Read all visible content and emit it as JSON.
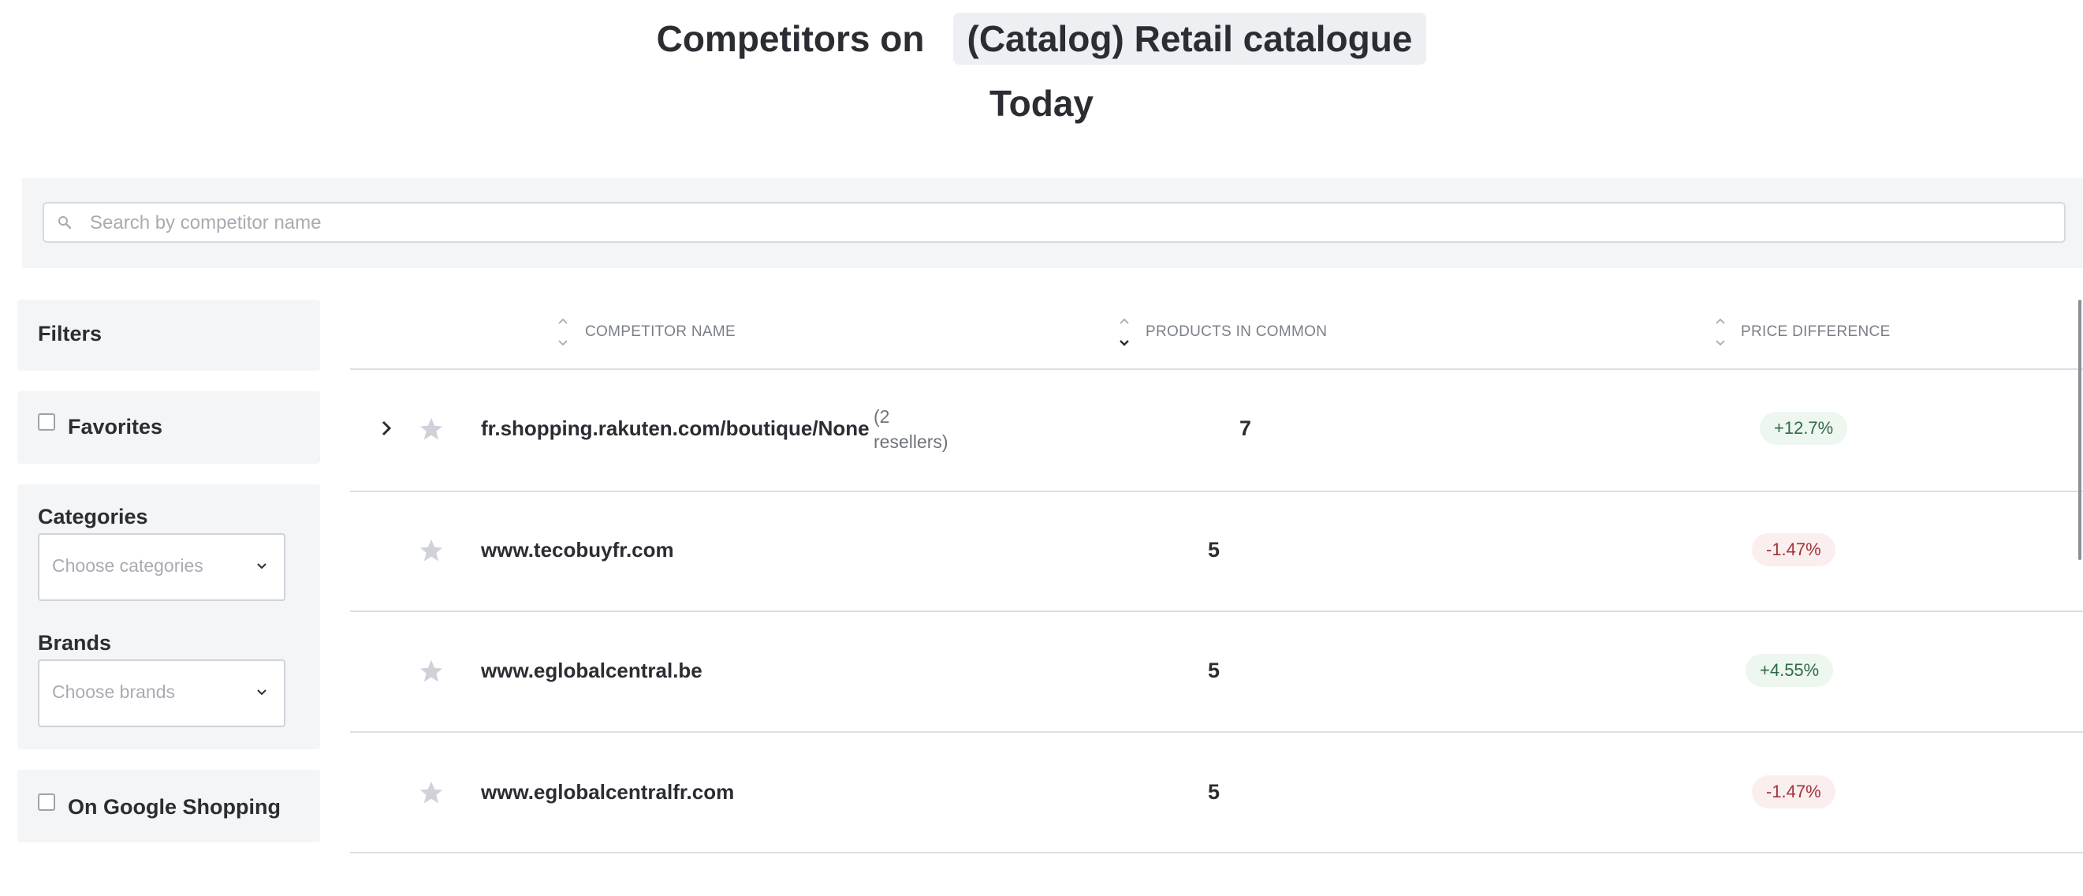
{
  "header": {
    "title_prefix": "Competitors on",
    "catalog_name": "(Catalog) Retail catalogue",
    "period": "Today"
  },
  "search": {
    "placeholder": "Search by competitor name",
    "value": ""
  },
  "filters": {
    "title": "Filters",
    "favorites_label": "Favorites",
    "favorites_checked": false,
    "categories_label": "Categories",
    "categories_placeholder": "Choose categories",
    "brands_label": "Brands",
    "brands_placeholder": "Choose brands",
    "google_shopping_label": "On Google Shopping",
    "google_shopping_checked": false
  },
  "table": {
    "columns": [
      "COMPETITOR NAME",
      "PRODUCTS IN COMMON",
      "PRICE DIFFERENCE"
    ],
    "rows": [
      {
        "name": "fr.shopping.rakuten.com/boutique/None",
        "resellers": "(2 resellers)",
        "products_in_common": "7",
        "price_difference": "+12.7%",
        "trend": "positive",
        "expandable": true
      },
      {
        "name": "www.tecobuyfr.com",
        "resellers": "",
        "products_in_common": "5",
        "price_difference": "-1.47%",
        "trend": "negative",
        "expandable": false
      },
      {
        "name": "www.eglobalcentral.be",
        "resellers": "",
        "products_in_common": "5",
        "price_difference": "+4.55%",
        "trend": "positive",
        "expandable": false
      },
      {
        "name": "www.eglobalcentralfr.com",
        "resellers": "",
        "products_in_common": "5",
        "price_difference": "-1.47%",
        "trend": "negative",
        "expandable": false
      }
    ]
  },
  "colors": {
    "positive_text": "#2f6b45",
    "positive_bg": "#eef6f0",
    "negative_text": "#a2343a",
    "negative_bg": "#fbeeee",
    "panel_bg": "#f4f5f7",
    "text": "#2b2d33"
  },
  "icons": {
    "search": "search-icon",
    "expand": "chevron-right-icon",
    "favorite": "star-icon",
    "dropdown": "chevron-down-icon",
    "sort": "sort-icon"
  }
}
